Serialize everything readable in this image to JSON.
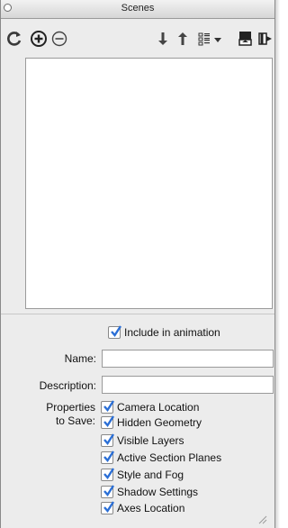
{
  "window": {
    "title": "Scenes"
  },
  "toolbar": {
    "buttons": [
      {
        "icon": "refresh-icon"
      },
      {
        "icon": "add-icon"
      },
      {
        "icon": "remove-icon"
      },
      {
        "icon": "move-down-icon"
      },
      {
        "icon": "move-up-icon"
      },
      {
        "icon": "view-options-icon"
      },
      {
        "icon": "show-details-icon"
      },
      {
        "icon": "hide-details-icon"
      }
    ]
  },
  "scene_list": {
    "items": []
  },
  "options": {
    "include_in_animation": {
      "label": "Include in animation",
      "checked": true
    },
    "name": {
      "label": "Name:",
      "value": ""
    },
    "description": {
      "label": "Description:",
      "value": ""
    },
    "properties_label_line1": "Properties",
    "properties_label_line2": "to Save:",
    "properties": [
      {
        "label": "Camera Location",
        "checked": true
      },
      {
        "label": "Hidden Geometry",
        "checked": true
      },
      {
        "label": "Visible Layers",
        "checked": true
      },
      {
        "label": "Active Section Planes",
        "checked": true
      },
      {
        "label": "Style and Fog",
        "checked": true
      },
      {
        "label": "Shadow Settings",
        "checked": true
      },
      {
        "label": "Axes Location",
        "checked": true
      }
    ]
  },
  "colors": {
    "check": "#2b6fd6",
    "panel_bg": "#ececec"
  }
}
